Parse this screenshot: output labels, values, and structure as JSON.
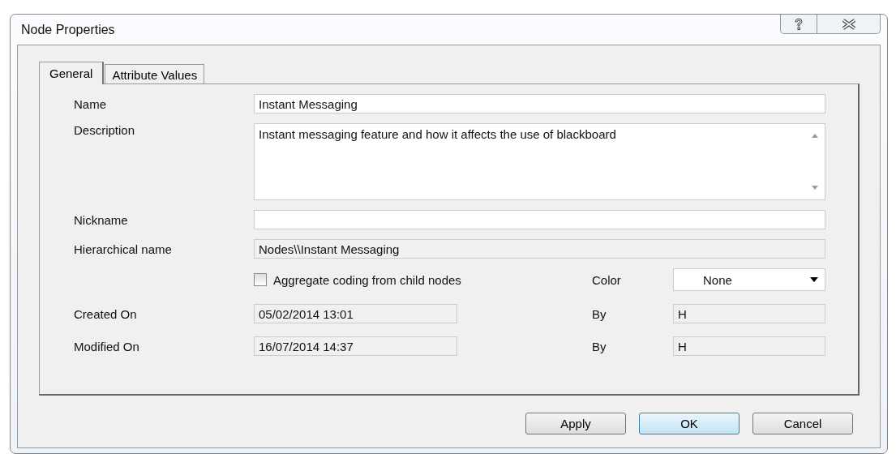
{
  "window": {
    "title": "Node Properties"
  },
  "tabs": [
    {
      "label": "General",
      "selected": true
    },
    {
      "label": "Attribute Values",
      "selected": false
    }
  ],
  "form": {
    "name_label": "Name",
    "name": "Instant Messaging",
    "description_label": "Description",
    "description": "Instant messaging feature and how it affects the use of blackboard",
    "nickname_label": "Nickname",
    "hierarchical_label": "Hierarchical name",
    "hierarchical_name": "Nodes\\\\Instant Messaging",
    "aggregate": {
      "label": "Aggregate coding from child nodes",
      "checked": false
    },
    "color_label": "Color",
    "color_choice": "None",
    "created_label": "Created On",
    "created": "05/02/2014 13:01",
    "created_by_label": "By",
    "created_by": "H",
    "modified_label": "Modified On",
    "modified": "16/07/2014 14:37",
    "modified_by_label": "By",
    "modified_by": "H"
  },
  "buttons": [
    {
      "label": "Apply",
      "selected": false
    },
    {
      "label": "OK",
      "selected": true
    },
    {
      "label": "Cancel",
      "selected": false
    }
  ]
}
